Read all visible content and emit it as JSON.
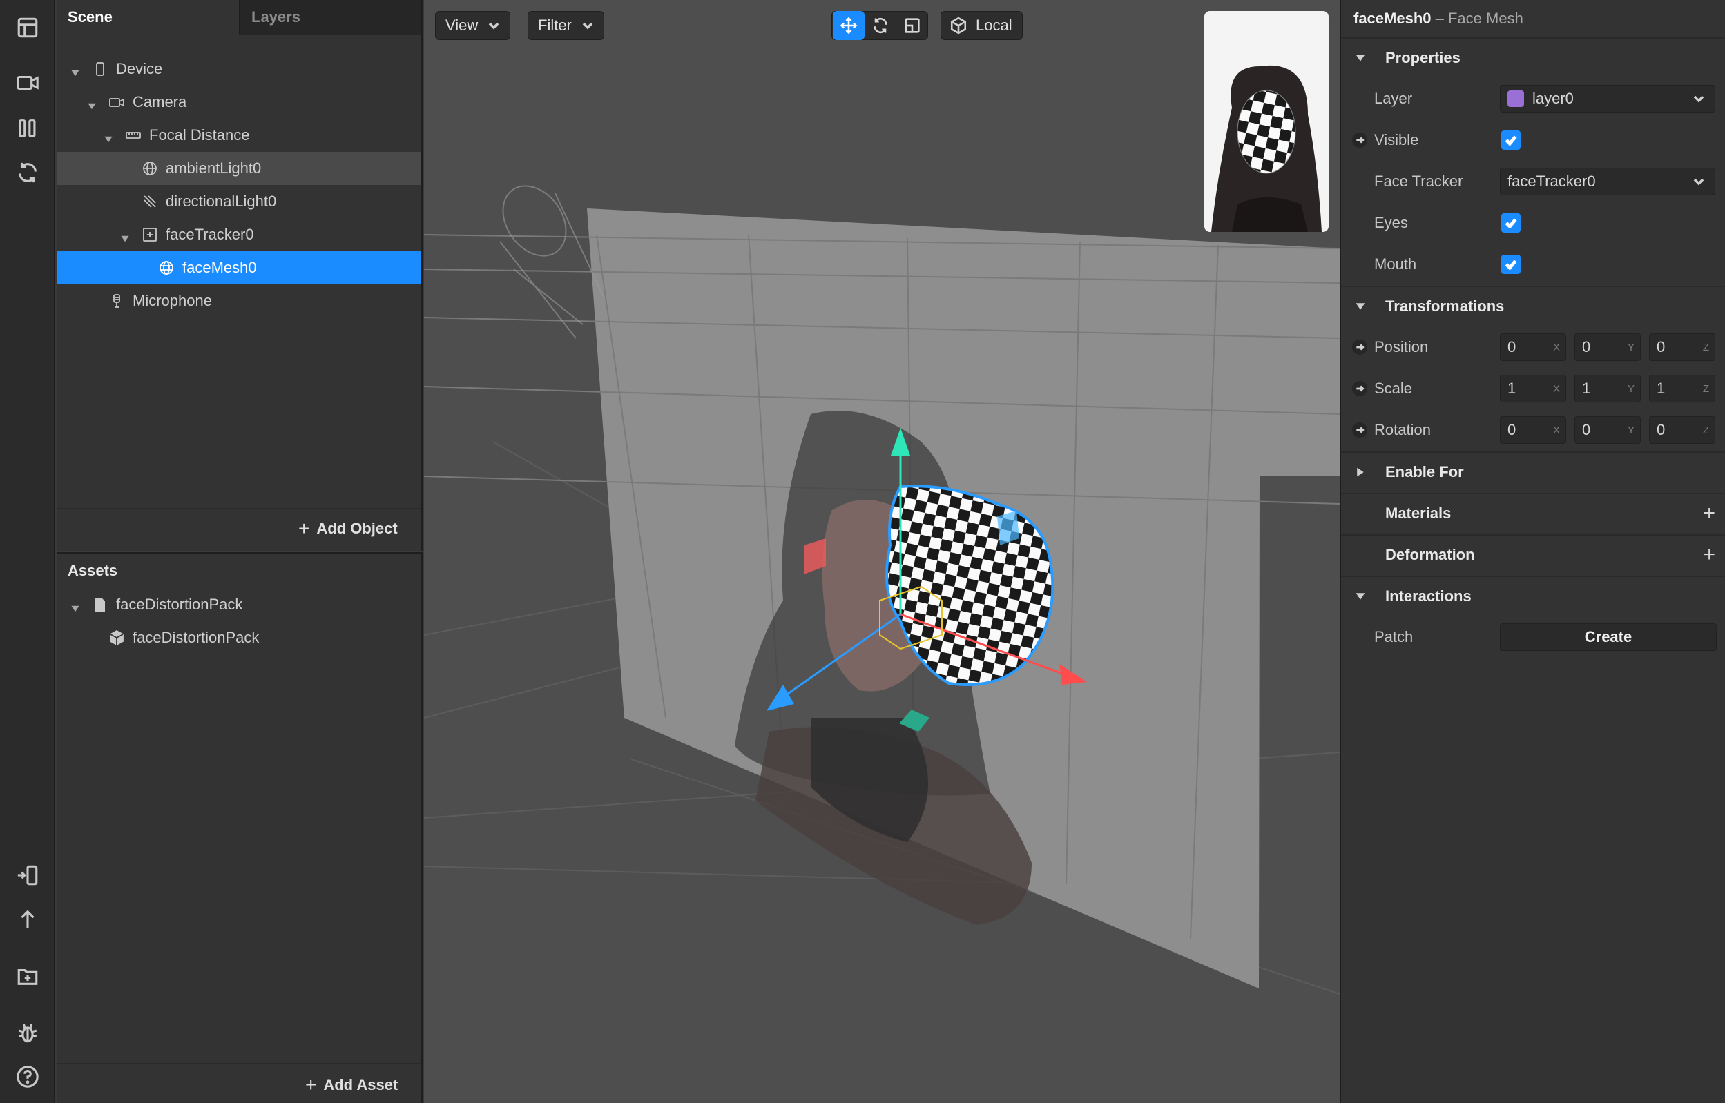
{
  "toolbar": {
    "icons": [
      "layout-icon",
      "video-icon",
      "patch-editor-icon",
      "refresh-icon",
      "send-to-device-icon",
      "upload-icon",
      "add-folder-icon",
      "bug-icon",
      "help-icon"
    ]
  },
  "scene_panel": {
    "tabs": [
      {
        "label": "Scene"
      },
      {
        "label": "Layers"
      }
    ],
    "tree": [
      {
        "label": "Device",
        "icon": "phone-icon"
      },
      {
        "label": "Camera",
        "icon": "camera-icon"
      },
      {
        "label": "Focal Distance",
        "icon": "ruler-icon"
      },
      {
        "label": "ambientLight0",
        "icon": "globe-light-icon"
      },
      {
        "label": "directionalLight0",
        "icon": "directional-light-icon"
      },
      {
        "label": "faceTracker0",
        "icon": "face-tracker-icon"
      },
      {
        "label": "faceMesh0",
        "icon": "mesh-icon"
      },
      {
        "label": "Microphone",
        "icon": "microphone-icon"
      }
    ],
    "add_object_label": "Add Object"
  },
  "assets_panel": {
    "title": "Assets",
    "tree": [
      {
        "label": "faceDistortionPack",
        "icon": "file-icon"
      },
      {
        "label": "faceDistortionPack",
        "icon": "cube-icon"
      }
    ],
    "add_asset_label": "Add Asset"
  },
  "viewport": {
    "view_label": "View",
    "filter_label": "Filter",
    "space_label": "Local",
    "tools": [
      "move-tool-icon",
      "rotate-tool-icon",
      "scale-tool-icon"
    ]
  },
  "inspector": {
    "title": "faceMesh0",
    "subtitle": "– Face Mesh",
    "sections": {
      "properties": "Properties",
      "transformations": "Transformations",
      "enable_for": "Enable For",
      "materials": "Materials",
      "deformation": "Deformation",
      "interactions": "Interactions"
    },
    "properties": {
      "layer_label": "Layer",
      "layer_value": "layer0",
      "layer_color": "#9a6fd6",
      "visible_label": "Visible",
      "visible": true,
      "face_tracker_label": "Face Tracker",
      "face_tracker_value": "faceTracker0",
      "eyes_label": "Eyes",
      "eyes": true,
      "mouth_label": "Mouth",
      "mouth": true
    },
    "transformations": {
      "axes": [
        "X",
        "Y",
        "Z"
      ],
      "position_label": "Position",
      "position": [
        "0",
        "0",
        "0"
      ],
      "scale_label": "Scale",
      "scale": [
        "1",
        "1",
        "1"
      ],
      "rotation_label": "Rotation",
      "rotation": [
        "0",
        "0",
        "0"
      ]
    },
    "interactions": {
      "patch_label": "Patch",
      "create_label": "Create"
    }
  },
  "colors": {
    "accent": "#1a8cff",
    "panel_bg": "#333333",
    "viewport_bg": "#4e4e4e"
  }
}
